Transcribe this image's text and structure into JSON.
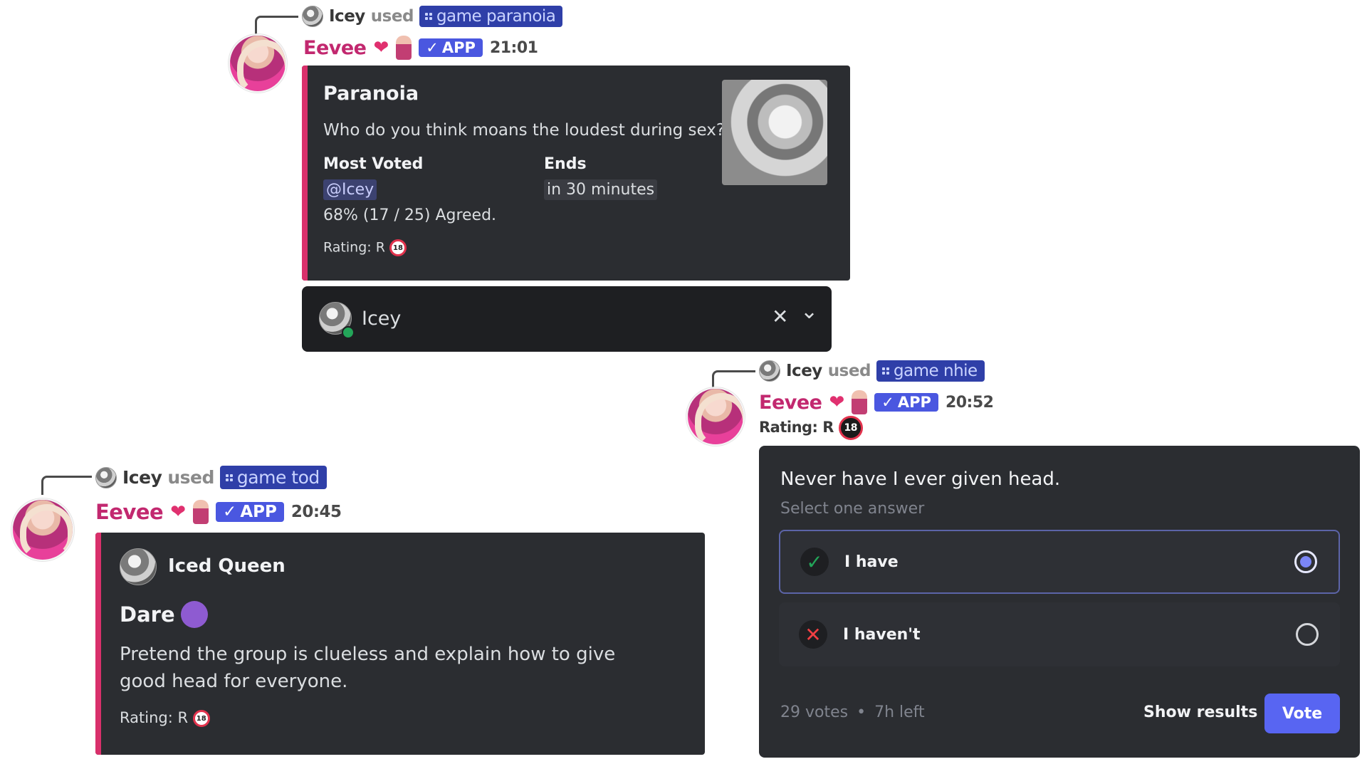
{
  "msg1": {
    "system": {
      "user": "Icey",
      "used": "used",
      "command": "game paranoia"
    },
    "author": "Eevee",
    "app_badge": "APP",
    "time": "21:01",
    "embed": {
      "title": "Paranoia",
      "question": "Who do you think moans the loudest during sex?",
      "most_voted_label": "Most Voted",
      "most_voted_value": "@Icey",
      "agreed": "68% (17 / 25) Agreed.",
      "ends_label": "Ends",
      "ends_value": "in 30 minutes",
      "rating": "Rating: R",
      "rating_icon": "18"
    },
    "select": {
      "value": "Icey",
      "clear": "✕",
      "chevron": "⌄"
    }
  },
  "msg2": {
    "system": {
      "user": "Icey",
      "used": "used",
      "command": "game nhie"
    },
    "author": "Eevee",
    "app_badge": "APP",
    "time": "20:52",
    "rating": "Rating: R",
    "rating_icon": "18",
    "poll": {
      "question": "Never have I ever given head.",
      "hint": "Select one answer",
      "answers": [
        {
          "label": "I have",
          "icon": "✓"
        },
        {
          "label": "I haven't",
          "icon": "✕"
        }
      ],
      "votes": "29 votes",
      "sep": "•",
      "time_left": "7h left",
      "show_results": "Show results",
      "vote": "Vote"
    }
  },
  "msg3": {
    "system": {
      "user": "Icey",
      "used": "used",
      "command": "game tod"
    },
    "author": "Eevee",
    "app_badge": "APP",
    "time": "20:45",
    "embed": {
      "author": "Iced Queen",
      "title": "Dare",
      "text": "Pretend the group is clueless and explain how to give good head for everyone.",
      "rating": "Rating: R",
      "rating_icon": "18"
    }
  },
  "colors": {
    "accent": "#5865f2",
    "embed_bar": "#d9306b",
    "username": "#c2286f",
    "embed_bg": "#2b2d31"
  }
}
